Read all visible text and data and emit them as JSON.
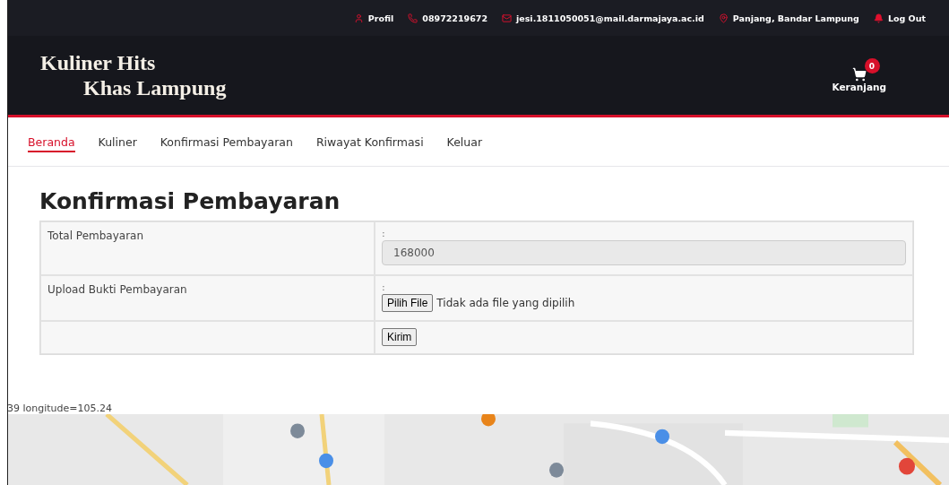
{
  "topbar": [
    {
      "kind": "user",
      "label": "Profil"
    },
    {
      "kind": "phone",
      "label": "08972219672"
    },
    {
      "kind": "mail",
      "label": "jesi.1811050051@mail.darmajaya.ac.id"
    },
    {
      "kind": "pin",
      "label": "Panjang, Bandar Lampung"
    },
    {
      "kind": "bell",
      "label": "Log Out"
    }
  ],
  "brand": {
    "line_1": "Kuliner Hits",
    "line_2": "Khas Lampung"
  },
  "cart": {
    "count": "0",
    "label": "Keranjang"
  },
  "nav": [
    {
      "label": "Beranda",
      "selected": true
    },
    {
      "label": "Kuliner",
      "selected": false
    },
    {
      "label": "Konfirmasi Pembayaran",
      "selected": false
    },
    {
      "label": "Riwayat Konfirmasi",
      "selected": false
    },
    {
      "label": "Keluar",
      "selected": false
    }
  ],
  "page_title": "Konfirmasi Pembayaran",
  "form": {
    "rows": [
      {
        "kind": "text",
        "label": "Total Pembayaran",
        "separator": ":",
        "value": "168000"
      },
      {
        "kind": "file",
        "label": "Upload Bukti Pembayaran",
        "separator": ":",
        "button": "Pilih File",
        "status": "Tidak ada file yang dipilih"
      },
      {
        "kind": "submit",
        "button": "Kirim"
      }
    ]
  },
  "coords_text": "39 longitude=105.24"
}
